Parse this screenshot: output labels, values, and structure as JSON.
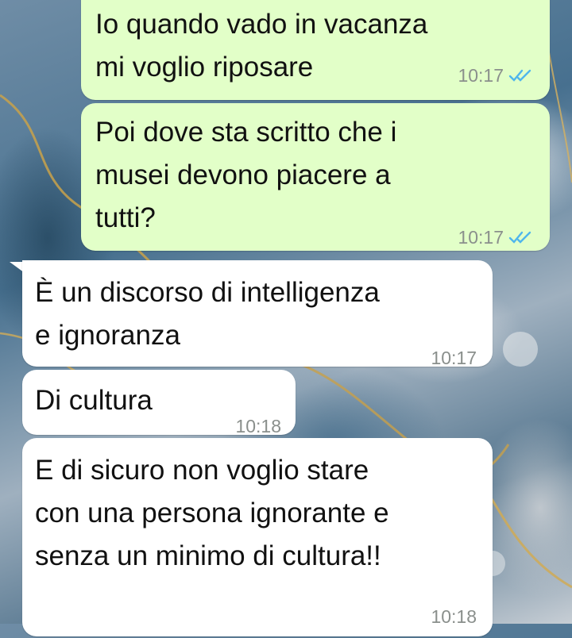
{
  "messages": [
    {
      "direction": "outgoing",
      "text": "Io quando vado in vacanza\nmi voglio riposare",
      "time": "10:17",
      "status": "read-double-tick-icon"
    },
    {
      "direction": "outgoing",
      "text": "Poi dove sta scritto che i\nmusei devono piacere a\ntutti?",
      "time": "10:17",
      "status": "read-double-tick-icon"
    },
    {
      "direction": "incoming",
      "text": "È un discorso di intelligenza\ne ignoranza",
      "time": "10:17"
    },
    {
      "direction": "incoming",
      "text": "Di cultura",
      "time": "10:18"
    },
    {
      "direction": "incoming",
      "text": "E di sicuro non voglio stare\ncon una persona ignorante e\nsenza un minimo di cultura!!",
      "time": "10:18"
    }
  ],
  "colors": {
    "outgoing_bubble": "#e2ffc8",
    "incoming_bubble": "#ffffff",
    "timestamp": "#8a8f8c",
    "read_tick": "#4fb6ec"
  }
}
